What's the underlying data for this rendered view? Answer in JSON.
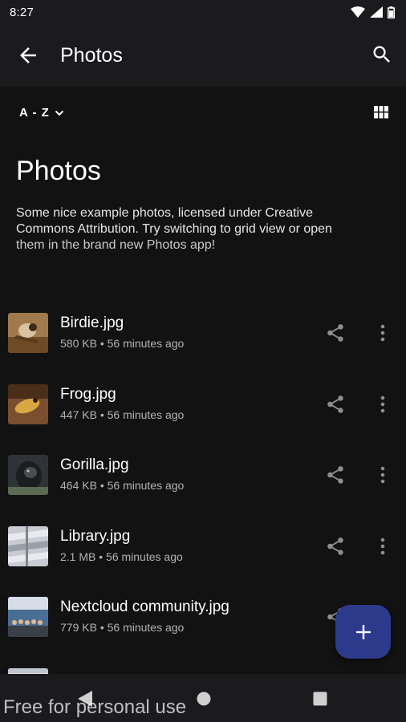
{
  "status_bar": {
    "time": "8:27",
    "icons": [
      "wifi-icon",
      "signal-icon",
      "battery-icon"
    ]
  },
  "app_bar": {
    "title": "Photos",
    "icons": [
      "back-arrow-icon",
      "search-icon"
    ]
  },
  "toolbar": {
    "sort_label": "A - Z",
    "icons": [
      "chevron-down-icon",
      "grid-view-icon"
    ]
  },
  "folder": {
    "title": "Photos",
    "description_lines": [
      "Some nice example photos, licensed under Creative",
      "Commons Attribution. Try switching to grid view or open",
      "them in the brand new Photos app!"
    ]
  },
  "files": [
    {
      "name": "Birdie.jpg",
      "meta": "580 KB • 56 minutes ago"
    },
    {
      "name": "Frog.jpg",
      "meta": "447 KB • 56 minutes ago"
    },
    {
      "name": "Gorilla.jpg",
      "meta": "464 KB • 56 minutes ago"
    },
    {
      "name": "Library.jpg",
      "meta": "2.1 MB • 56 minutes ago"
    },
    {
      "name": "Nextcloud community.jpg",
      "meta": "779 KB • 56 minutes ago"
    }
  ],
  "row_icons": [
    "share-icon",
    "more-vert-icon"
  ],
  "fab": {
    "icon": "plus-icon",
    "color": "#2d3a8c"
  },
  "nav_bar": {
    "icons": [
      "nav-back-icon",
      "nav-home-icon",
      "nav-recents-icon"
    ]
  },
  "watermark": "Free for personal use",
  "colors": {
    "background": "#121212",
    "app_bar": "#1b1b1d",
    "fab": "#2d3a8c",
    "secondary_text": "#b3b3b3"
  }
}
